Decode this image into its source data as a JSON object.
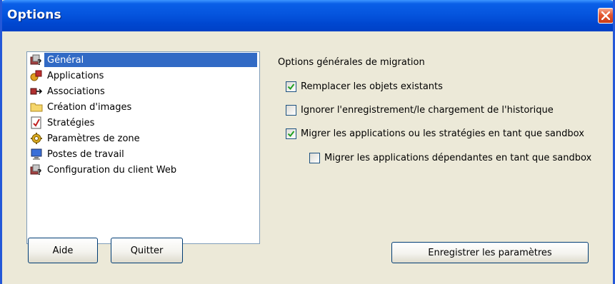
{
  "window": {
    "title": "Options"
  },
  "list": {
    "items": [
      {
        "label": "Général",
        "icon": "general-icon",
        "selected": true
      },
      {
        "label": "Applications",
        "icon": "applications-icon",
        "selected": false
      },
      {
        "label": "Associations",
        "icon": "associations-icon",
        "selected": false
      },
      {
        "label": "Création d'images",
        "icon": "folder-icon",
        "selected": false
      },
      {
        "label": "Stratégies",
        "icon": "policy-icon",
        "selected": false
      },
      {
        "label": "Paramètres de zone",
        "icon": "zone-settings-icon",
        "selected": false
      },
      {
        "label": "Postes de travail",
        "icon": "workstation-icon",
        "selected": false
      },
      {
        "label": "Configuration du client Web",
        "icon": "web-client-icon",
        "selected": false
      }
    ]
  },
  "options": {
    "group_title": "Options générales de migration",
    "checkboxes": [
      {
        "label": "Remplacer les objets existants",
        "checked": true
      },
      {
        "label": "Ignorer l'enregistrement/le chargement de l'historique",
        "checked": false
      },
      {
        "label": "Migrer les applications ou les stratégies en tant que sandbox",
        "checked": true
      },
      {
        "label": "Migrer les applications dépendantes en tant que sandbox",
        "checked": false
      }
    ]
  },
  "buttons": {
    "help": "Aide",
    "quit": "Quitter",
    "save": "Enregistrer les paramètres"
  },
  "colors": {
    "title_bar": "#0555de",
    "selection": "#316ac5",
    "dialog_bg": "#ece9d8",
    "close_button": "#e4572f"
  }
}
